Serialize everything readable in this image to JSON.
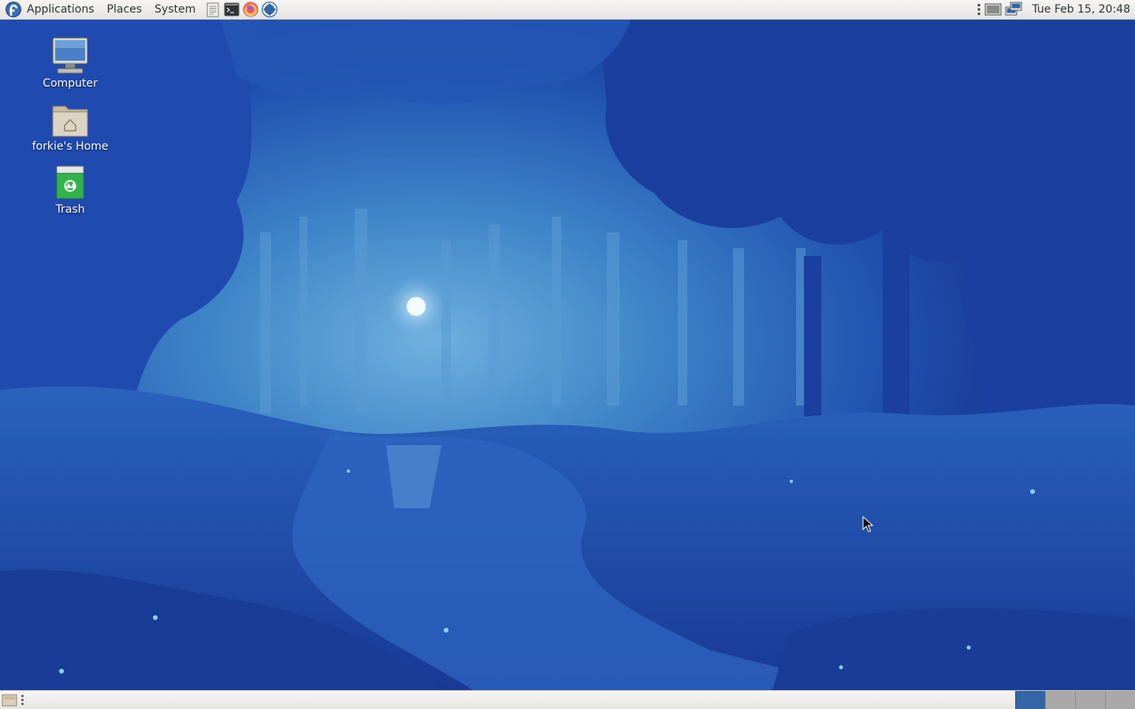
{
  "top_panel": {
    "menus": {
      "applications": "Applications",
      "places": "Places",
      "system": "System"
    },
    "launchers": [
      "text-editor-icon",
      "terminal-icon",
      "firefox-icon",
      "help-icon"
    ],
    "tray_icons": [
      "notification-handle-icon",
      "display-icon",
      "network-icon"
    ],
    "clock": "Tue Feb 15, 20:48"
  },
  "desktop": {
    "icons": [
      {
        "name": "computer-icon",
        "label": "Computer"
      },
      {
        "name": "home-folder-icon",
        "label": "forkie's Home"
      },
      {
        "name": "trash-icon",
        "label": "Trash"
      }
    ]
  },
  "bottom_panel": {
    "workspaces": {
      "count": 4,
      "active_index": 0
    },
    "colors": {
      "active_workspace": "#3465a4",
      "inactive_workspace": "#a9a9a7"
    }
  },
  "colors": {
    "panel_bg": "#ece9e6",
    "wallpaper_base": "#1d3f9a",
    "wallpaper_light": "#4a8fd0"
  }
}
